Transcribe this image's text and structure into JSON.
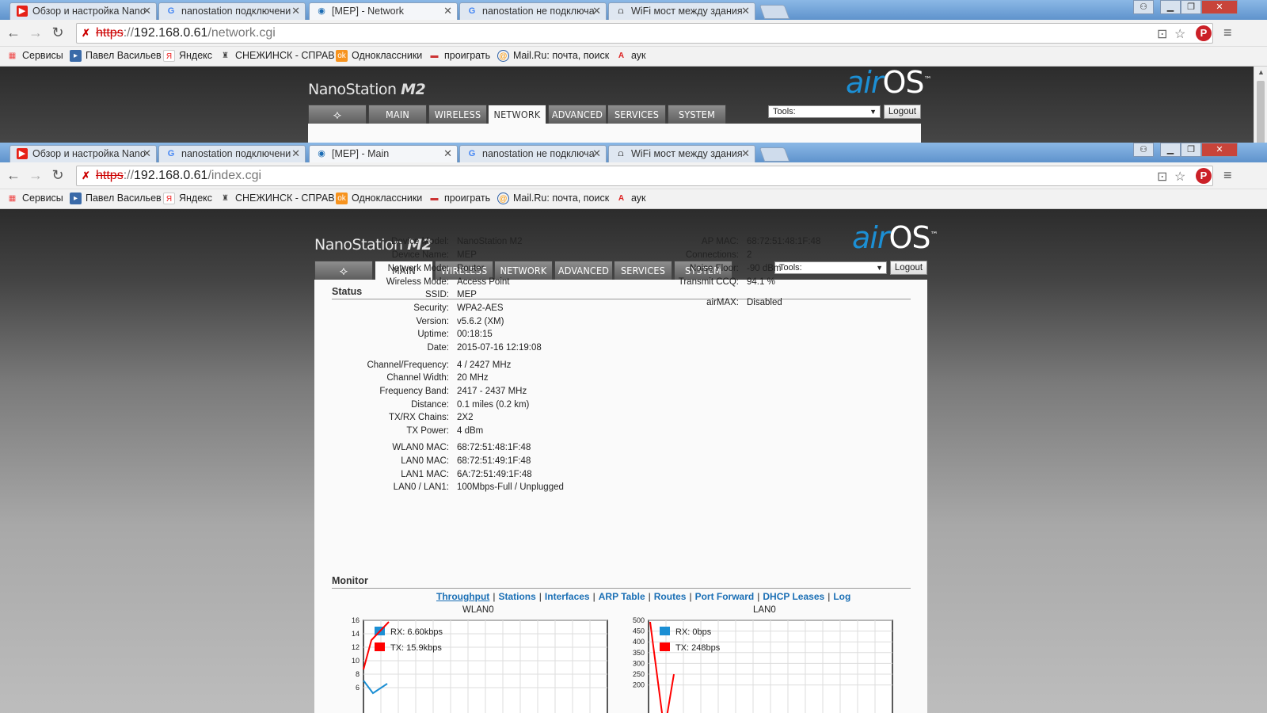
{
  "browser": {
    "tabs": [
      {
        "title": "Обзор и настройка Nano",
        "icon": "youtube-icon",
        "color": "#e62117"
      },
      {
        "title": "nanostation подключени",
        "icon": "google-icon",
        "color": "#4285f4"
      },
      {
        "title": "[MEP] - Network",
        "icon": "wifi-icon",
        "color": "#1c6cb4"
      },
      {
        "title": "nanostation не подключа",
        "icon": "google-icon",
        "color": "#4285f4"
      },
      {
        "title": "WiFi мост между здания",
        "icon": "router-icon",
        "color": "#333"
      }
    ],
    "tabs2": [
      {
        "title": "Обзор и настройка Nano",
        "icon": "youtube-icon",
        "color": "#e62117"
      },
      {
        "title": "nanostation подключени",
        "icon": "google-icon",
        "color": "#4285f4"
      },
      {
        "title": "[MEP] - Main",
        "icon": "wifi-icon",
        "color": "#1c6cb4"
      },
      {
        "title": "nanostation не подключа",
        "icon": "google-icon",
        "color": "#4285f4"
      },
      {
        "title": "WiFi мост между здания",
        "icon": "router-icon",
        "color": "#333"
      }
    ],
    "url1": {
      "scheme": "https",
      "sep": "://",
      "host": "192.168.0.61",
      "path": "/network.cgi"
    },
    "url2": {
      "scheme": "https",
      "sep": "://",
      "host": "192.168.0.61",
      "path": "/index.cgi"
    },
    "bookmarks": [
      {
        "label": "Сервисы",
        "icon": "apps-grid-icon",
        "color": "#e44"
      },
      {
        "label": "Павел Васильев",
        "icon": "bookmark-page-icon",
        "color": "#3a6aa8"
      },
      {
        "label": "Яндекс",
        "icon": "yandex-icon",
        "color": "#e22"
      },
      {
        "label": "СНЕЖИНСК - СПРАВ",
        "icon": "city-icon",
        "color": "#555"
      },
      {
        "label": "Одноклассники",
        "icon": "odnoklassniki-icon",
        "color": "#f7931e"
      },
      {
        "label": "проиграть",
        "icon": "game-icon",
        "color": "#c33"
      },
      {
        "label": "Mail.Ru: почта, поиск",
        "icon": "mailru-icon",
        "color": "#f90"
      },
      {
        "label": "аук",
        "icon": "auction-icon",
        "color": "#d22"
      }
    ]
  },
  "device_ui": {
    "brand": "NanoStation",
    "brand_model": "M2",
    "airos_air": "air",
    "airos_os": "OS",
    "airos_tm": "™",
    "nav_tabs": [
      "MAIN",
      "WIRELESS",
      "NETWORK",
      "ADVANCED",
      "SERVICES",
      "SYSTEM"
    ],
    "tools_label": "Tools:",
    "logout_label": "Logout"
  },
  "status": {
    "title": "Status",
    "left": [
      {
        "label": "Device Model:",
        "value": "NanoStation M2"
      },
      {
        "label": "Device Name:",
        "value": "MEP"
      },
      {
        "label": "Network Mode:",
        "value": "Router"
      },
      {
        "label": "Wireless Mode:",
        "value": "Access Point"
      },
      {
        "label": "SSID:",
        "value": "MEP"
      },
      {
        "label": "Security:",
        "value": "WPA2-AES"
      },
      {
        "label": "Version:",
        "value": "v5.6.2 (XM)"
      },
      {
        "label": "Uptime:",
        "value": "00:18:15"
      },
      {
        "label": "Date:",
        "value": "2015-07-16 12:19:08"
      },
      {
        "label": "Channel/Frequency:",
        "value": "4 / 2427 MHz"
      },
      {
        "label": "Channel Width:",
        "value": "20 MHz"
      },
      {
        "label": "Frequency Band:",
        "value": "2417 - 2437 MHz"
      },
      {
        "label": "Distance:",
        "value": "0.1 miles (0.2 km)"
      },
      {
        "label": "TX/RX Chains:",
        "value": "2X2"
      },
      {
        "label": "TX Power:",
        "value": "4 dBm"
      },
      {
        "label": "WLAN0 MAC:",
        "value": "68:72:51:48:1F:48"
      },
      {
        "label": "LAN0 MAC:",
        "value": "68:72:51:49:1F:48"
      },
      {
        "label": "LAN1 MAC:",
        "value": "6A:72:51:49:1F:48"
      },
      {
        "label": "LAN0 / LAN1:",
        "value": "100Mbps-Full / Unplugged"
      }
    ],
    "right": [
      {
        "label": "AP MAC:",
        "value": "68:72:51:48:1F:48"
      },
      {
        "label": "Connections:",
        "value": "2"
      },
      {
        "label": "Noise Floor:",
        "value": "-90 dBm"
      },
      {
        "label": "Transmit CCQ:",
        "value": "94.1 %"
      },
      {
        "label": "airMAX:",
        "value": "Disabled"
      }
    ]
  },
  "monitor": {
    "title": "Monitor",
    "links": [
      "Throughput",
      "Stations",
      "Interfaces",
      "ARP Table",
      "Routes",
      "Port Forward",
      "DHCP Leases",
      "Log"
    ],
    "separator": "|"
  },
  "chart_data": [
    {
      "type": "line",
      "title": "WLAN0",
      "yticks": [
        16,
        14,
        12,
        10,
        8,
        6
      ],
      "ylim": [
        6,
        16
      ],
      "series": [
        {
          "name": "RX: 6.60kbps",
          "color": "#1c8fd4"
        },
        {
          "name": "TX: 15.9kbps",
          "color": "#ff0000"
        }
      ]
    },
    {
      "type": "line",
      "title": "LAN0",
      "yticks": [
        500,
        450,
        400,
        350,
        300,
        250,
        200
      ],
      "ylim": [
        200,
        500
      ],
      "series": [
        {
          "name": "RX: 0bps",
          "color": "#1c8fd4"
        },
        {
          "name": "TX: 248bps",
          "color": "#ff0000"
        }
      ]
    }
  ]
}
